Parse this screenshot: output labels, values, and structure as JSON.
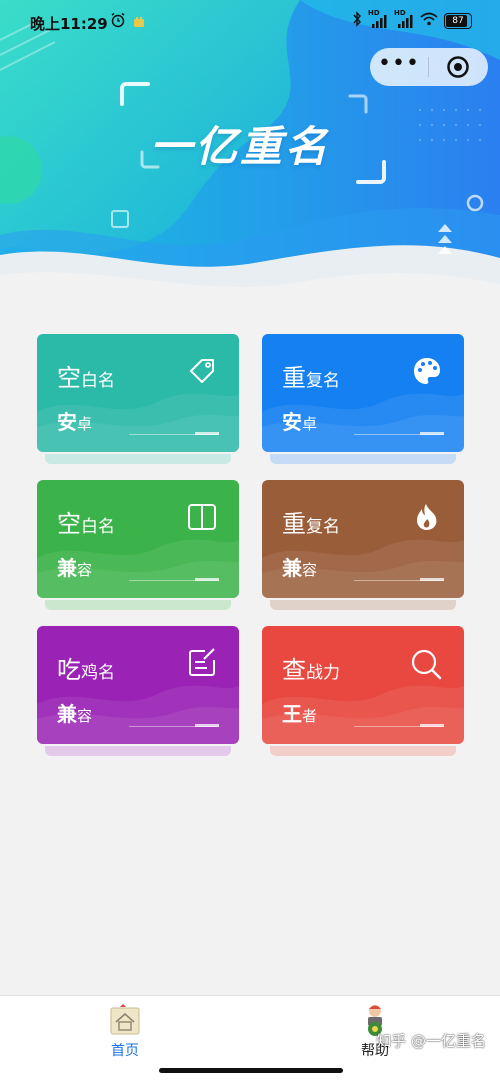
{
  "status_bar": {
    "time": "晚上11:29",
    "battery": "87",
    "network_1": "HD",
    "network_2": "HD"
  },
  "capsule": {
    "more_label": "•••",
    "more_icon": "more-dots-icon",
    "close_icon": "target-circle-icon"
  },
  "banner": {
    "title": "一亿重名"
  },
  "cards": [
    {
      "title_big": "空",
      "title_rest": "白名",
      "sub_big": "安",
      "sub_rest": "卓",
      "icon": "tag-icon",
      "color": "#2bb9a8",
      "color2": "#31c6b5"
    },
    {
      "title_big": "重",
      "title_rest": "复名",
      "sub_big": "安",
      "sub_rest": "卓",
      "icon": "palette-icon",
      "color": "#1580f2",
      "color2": "#2b8ff6"
    },
    {
      "title_big": "空",
      "title_rest": "白名",
      "sub_big": "兼",
      "sub_rest": "容",
      "icon": "book-icon",
      "color": "#3cb24a",
      "color2": "#47bd55"
    },
    {
      "title_big": "重",
      "title_rest": "复名",
      "sub_big": "兼",
      "sub_rest": "容",
      "icon": "fire-icon",
      "color": "#9a5d3a",
      "color2": "#a86a47"
    },
    {
      "title_big": "吃",
      "title_rest": "鸡名",
      "sub_big": "兼",
      "sub_rest": "容",
      "icon": "edit-icon",
      "color": "#9a22b5",
      "color2": "#a731c0"
    },
    {
      "title_big": "查",
      "title_rest": "战力",
      "sub_big": "王",
      "sub_rest": "者",
      "icon": "search-icon",
      "color": "#e8483f",
      "color2": "#ee5a50"
    }
  ],
  "tabbar": {
    "home_label": "首页",
    "help_label": "帮助",
    "home_icon": "home-icon",
    "help_icon": "help-icon"
  },
  "watermark": "知乎 @一亿重名"
}
